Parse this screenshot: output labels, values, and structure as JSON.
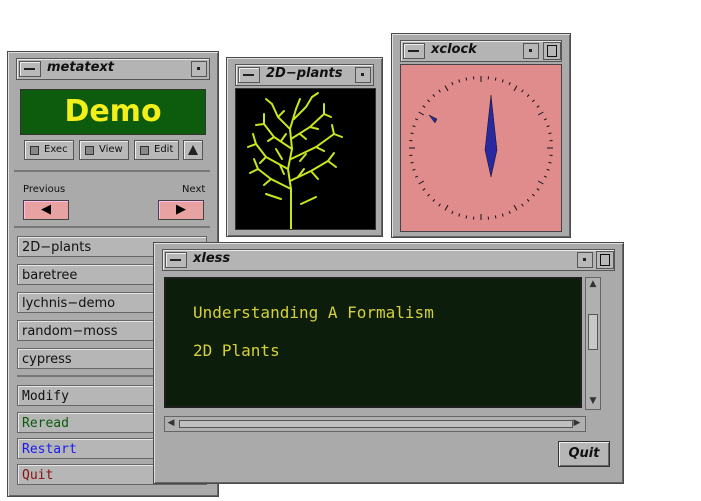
{
  "metatext": {
    "title": "metatext",
    "banner": "Demo",
    "modes": [
      {
        "label": "Exec"
      },
      {
        "label": "View"
      },
      {
        "label": "Edit"
      }
    ],
    "previous_label": "Previous",
    "next_label": "Next",
    "prev_arrow": "◀",
    "next_arrow": "▶",
    "demos": [
      {
        "label": "2D−plants"
      },
      {
        "label": "baretree"
      },
      {
        "label": "lychnis−demo"
      },
      {
        "label": "random−moss"
      },
      {
        "label": "cypress"
      }
    ],
    "commands": [
      {
        "label": "Modify",
        "color": "#111111"
      },
      {
        "label": "Reread",
        "color": "#0b5a0b"
      },
      {
        "label": "Restart",
        "color": "#1a1aee"
      },
      {
        "label": "Quit",
        "color": "#8a1010"
      }
    ]
  },
  "plants": {
    "title": "2D−plants",
    "colors": {
      "branch": "#c7e81c",
      "trunk": "#d8e01a"
    }
  },
  "xclock": {
    "title": "xclock",
    "face_color": "#e08c8c",
    "hand_color": "#2828a0"
  },
  "xless": {
    "title": "xless",
    "lines": [
      "Understanding A Formalism",
      "2D Plants"
    ],
    "quit_label": "Quit"
  }
}
